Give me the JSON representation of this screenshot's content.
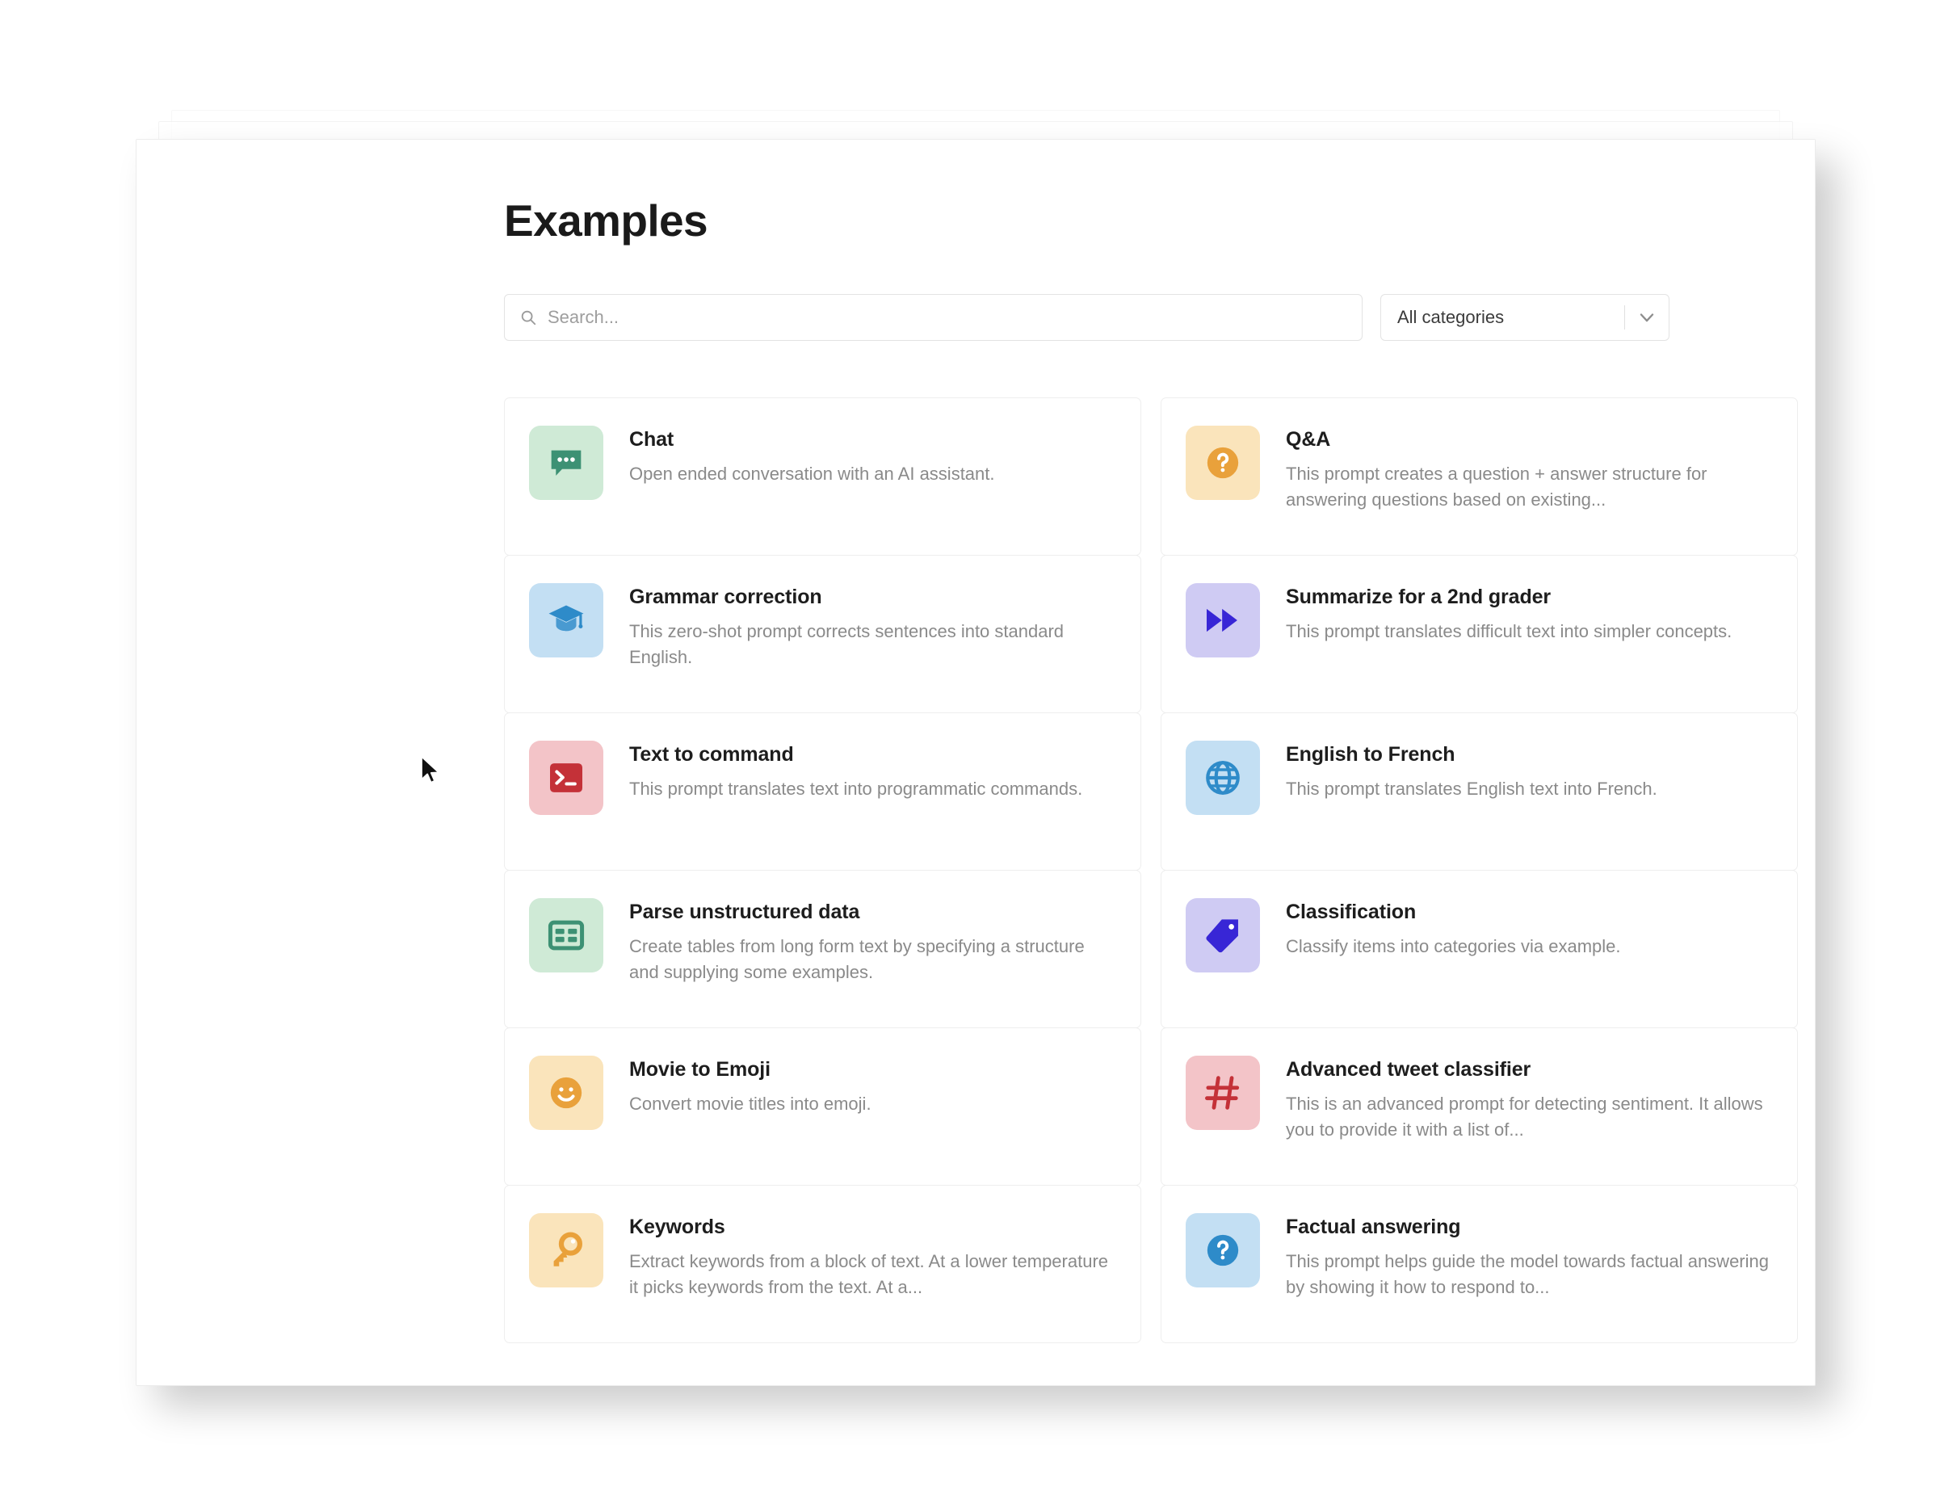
{
  "page": {
    "title": "Examples"
  },
  "search": {
    "placeholder": "Search...",
    "value": "",
    "icon": "search-icon"
  },
  "category_filter": {
    "selected": "All categories",
    "chevron_icon": "chevron-down-icon"
  },
  "colors": {
    "green_tile": "#cfead6",
    "green_glyph": "#3d9174",
    "amber_tile": "#fae4bb",
    "amber_glyph": "#e9a13b",
    "blue_tile": "#c3dff3",
    "blue_glyph": "#2e8bc9",
    "purple_tile": "#cfcbf3",
    "purple_glyph": "#3826d6",
    "red_tile": "#f3c4c8",
    "red_glyph": "#c43138",
    "title_text": "#1d1d1d",
    "desc_text": "#8a8a8a",
    "card_border": "#eeeeee"
  },
  "cards": [
    {
      "title": "Chat",
      "description": "Open ended conversation with an AI assistant.",
      "icon": "chat-bubble-icon",
      "tile": "green",
      "glyph": "green_glyph"
    },
    {
      "title": "Q&A",
      "description": "This prompt creates a question + answer structure for answering questions based on existing...",
      "icon": "question-circle-icon",
      "tile": "amber",
      "glyph": "amber_glyph"
    },
    {
      "title": "Grammar correction",
      "description": "This zero-shot prompt corrects sentences into standard English.",
      "icon": "graduation-cap-icon",
      "tile": "blue",
      "glyph": "blue_glyph"
    },
    {
      "title": "Summarize for a 2nd grader",
      "description": "This prompt translates difficult text into simpler concepts.",
      "icon": "fast-forward-icon",
      "tile": "purple",
      "glyph": "purple_glyph"
    },
    {
      "title": "Text to command",
      "description": "This prompt translates text into programmatic commands.",
      "icon": "terminal-icon",
      "tile": "red",
      "glyph": "red_glyph"
    },
    {
      "title": "English to French",
      "description": "This prompt translates English text into French.",
      "icon": "globe-icon",
      "tile": "blue",
      "glyph": "blue_glyph"
    },
    {
      "title": "Parse unstructured data",
      "description": "Create tables from long form text by specifying a structure and supplying some examples.",
      "icon": "table-grid-icon",
      "tile": "green",
      "glyph": "green_glyph"
    },
    {
      "title": "Classification",
      "description": "Classify items into categories via example.",
      "icon": "tag-icon",
      "tile": "purple",
      "glyph": "purple_glyph"
    },
    {
      "title": "Movie to Emoji",
      "description": "Convert movie titles into emoji.",
      "icon": "smiley-face-icon",
      "tile": "amber",
      "glyph": "amber_glyph"
    },
    {
      "title": "Advanced tweet classifier",
      "description": "This is an advanced prompt for detecting sentiment. It allows you to provide it with a list of...",
      "icon": "hashtag-icon",
      "tile": "red",
      "glyph": "red_glyph"
    },
    {
      "title": "Keywords",
      "description": "Extract keywords from a block of text. At a lower temperature it picks keywords from the text. At a...",
      "icon": "key-icon",
      "tile": "amber",
      "glyph": "amber_glyph"
    },
    {
      "title": "Factual answering",
      "description": "This prompt helps guide the model towards factual answering by showing it how to respond to...",
      "icon": "question-circle-icon",
      "tile": "blue",
      "glyph": "blue_glyph"
    }
  ]
}
